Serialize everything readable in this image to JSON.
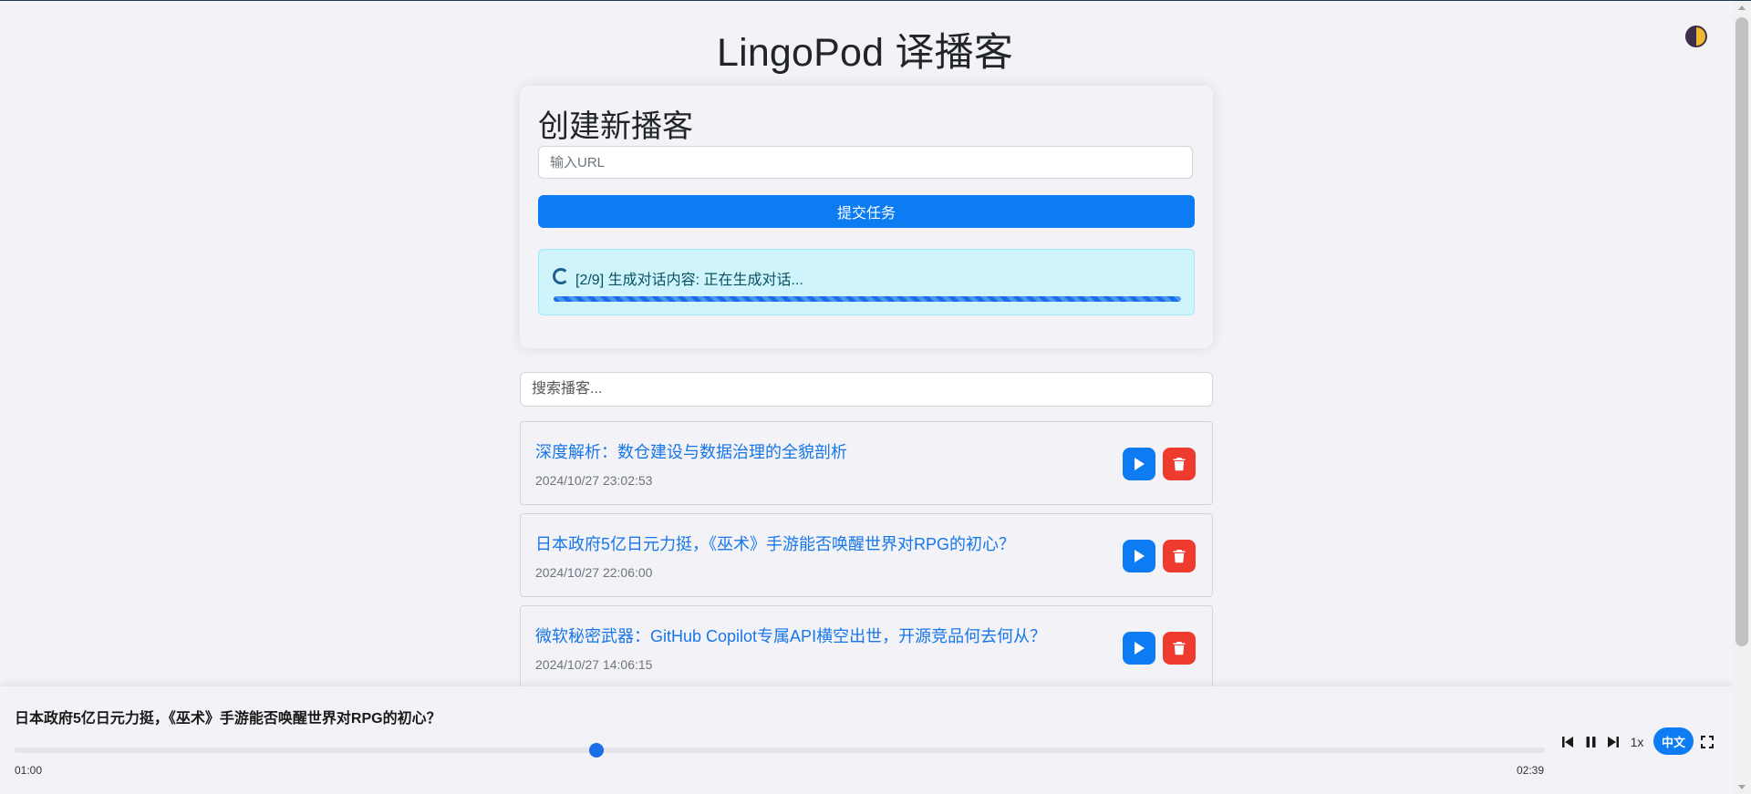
{
  "app": {
    "title": "LingoPod 译播客"
  },
  "create": {
    "heading": "创建新播客",
    "url_placeholder": "输入URL",
    "submit_label": "提交任务",
    "status_text": "[2/9] 生成对话内容: 正在生成对话...",
    "progress_fraction": 1.0
  },
  "search": {
    "placeholder": "搜索播客..."
  },
  "podcasts": [
    {
      "title": "深度解析：数仓建设与数据治理的全貌剖析",
      "date": "2024/10/27 23:02:53"
    },
    {
      "title": "日本政府5亿日元力挺，《巫术》手游能否唤醒世界对RPG的初心？",
      "date": "2024/10/27 22:06:00"
    },
    {
      "title": "微软秘密武器：GitHub Copilot专属API横空出世，开源竞品何去何从？",
      "date": "2024/10/27 14:06:15"
    }
  ],
  "player": {
    "now_playing": "日本政府5亿日元力挺，《巫术》手游能否唤醒世界对RPG的初心？",
    "current_time": "01:00",
    "total_time": "02:39",
    "progress_fraction": 0.38,
    "speed": "1x",
    "language": "中文"
  },
  "icons": {
    "theme": "half-moon-theme-icon",
    "spinner": "loading-spinner-icon",
    "play": "play-icon",
    "delete": "trash-icon",
    "prev": "skip-previous-icon",
    "pause": "pause-icon",
    "next": "skip-next-icon",
    "fullscreen": "fullscreen-icon"
  },
  "colors": {
    "primary": "#0d7cf2",
    "danger": "#ef3b2d",
    "link": "#1877e8",
    "status_bg": "#cff4fc"
  }
}
